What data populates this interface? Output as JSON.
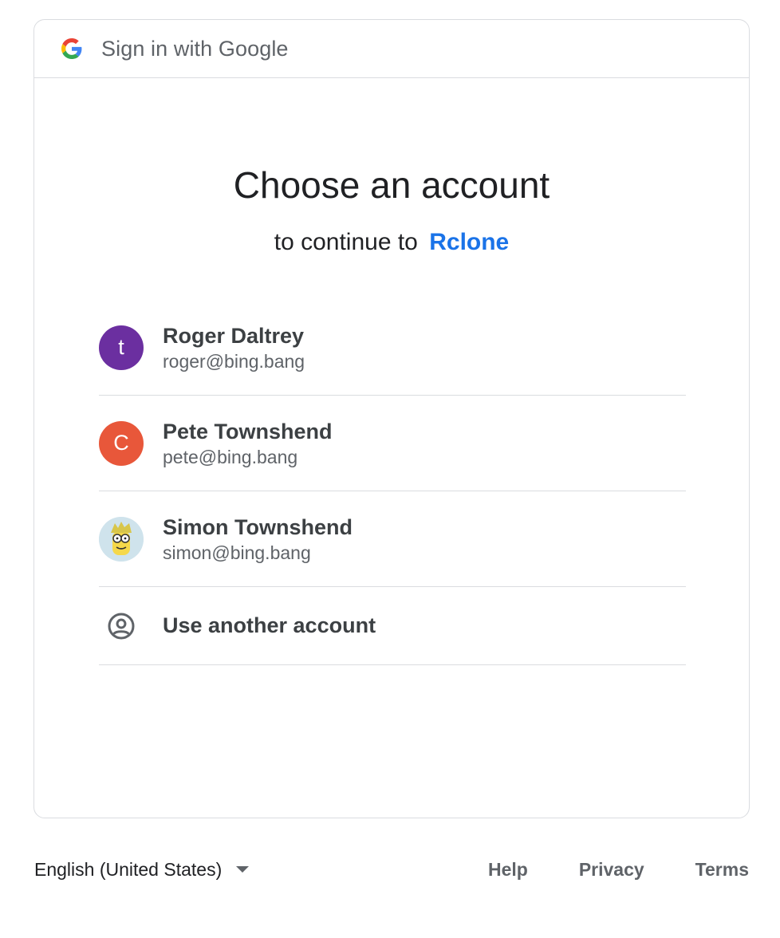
{
  "header": {
    "title": "Sign in with Google",
    "logo_icon": "google-g-icon"
  },
  "main": {
    "title": "Choose an account",
    "subtitle_prefix": "to continue to",
    "app_name": "Rclone",
    "app_color": "#1a73e8"
  },
  "accounts": [
    {
      "name": "Roger Daltrey",
      "email": "roger@bing.bang",
      "initial": "t",
      "avatar_color": "#6b2fa0"
    },
    {
      "name": "Pete Townshend",
      "email": "pete@bing.bang",
      "initial": "C",
      "avatar_color": "#e8573a"
    },
    {
      "name": "Simon Townshend",
      "email": "simon@bing.bang",
      "avatar_icon": "cartoon-avatar-icon"
    }
  ],
  "another_account": {
    "label": "Use another account",
    "icon": "account-circle-icon"
  },
  "footer": {
    "language": "English (United States)",
    "links": [
      "Help",
      "Privacy",
      "Terms"
    ]
  }
}
